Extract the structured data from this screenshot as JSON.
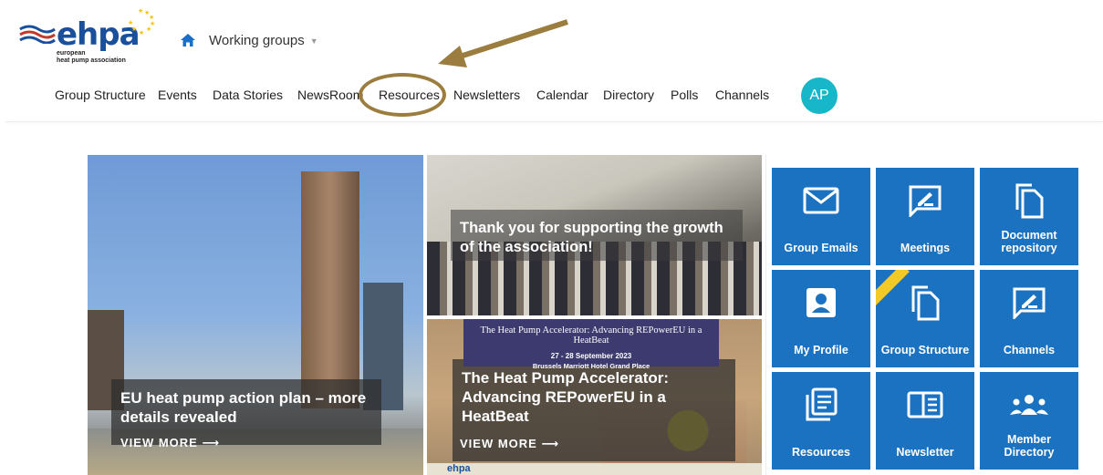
{
  "brand": {
    "name": "ehpa",
    "subtitle_line1": "european",
    "subtitle_line2": "heat pump association",
    "color": "#1a4f9c"
  },
  "header": {
    "breadcrumb": "Working groups",
    "home_icon": "home-icon",
    "caret_icon": "caret-down-icon"
  },
  "nav": {
    "items": [
      {
        "label": "Group Structure"
      },
      {
        "label": "Events"
      },
      {
        "label": "Data Stories"
      },
      {
        "label": "NewsRoom"
      },
      {
        "label": "Resources"
      },
      {
        "label": "Newsletters"
      },
      {
        "label": "Calendar"
      },
      {
        "label": "Directory"
      },
      {
        "label": "Polls"
      },
      {
        "label": "Channels"
      }
    ],
    "highlighted": "Resources"
  },
  "user": {
    "initials": "AP",
    "avatar_color": "#17b7c9"
  },
  "annotation": {
    "color": "#9b7e3f"
  },
  "cards": [
    {
      "title": "EU heat pump action plan – more details revealed",
      "cta": "VIEW MORE"
    },
    {
      "title": "Thank you for supporting the growth of the association!"
    },
    {
      "title": "The Heat Pump Accelerator: Advancing REPowerEU in a HeatBeat",
      "cta": "VIEW MORE",
      "banner_title": "The Heat Pump Accelerator: Advancing REPowerEU in a HeatBeat",
      "banner_date": "27 - 28 September 2023",
      "banner_venue": "Brussels Marriott Hotel Grand Place",
      "footer_logo": "ehpa"
    }
  ],
  "tiles": [
    {
      "label": "Group Emails",
      "icon": "envelope-icon"
    },
    {
      "label": "Meetings",
      "icon": "chat-edit-icon"
    },
    {
      "label": "Document repository",
      "icon": "documents-icon"
    },
    {
      "label": "My Profile",
      "icon": "profile-icon"
    },
    {
      "label": "Group Structure",
      "icon": "documents-icon"
    },
    {
      "label": "Channels",
      "icon": "chat-edit-icon"
    },
    {
      "label": "Resources",
      "icon": "resources-icon"
    },
    {
      "label": "Newsletter",
      "icon": "newsletter-icon"
    },
    {
      "label": "Member Directory",
      "icon": "members-icon"
    }
  ],
  "colors": {
    "tile": "#1a72c0",
    "ribbon": "#f3c928"
  }
}
